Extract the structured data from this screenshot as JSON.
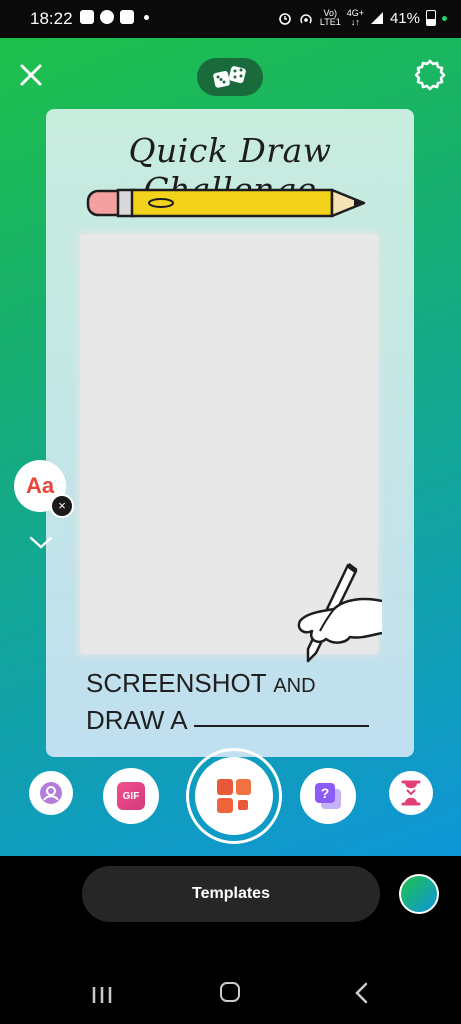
{
  "status_bar": {
    "time": "18:22",
    "network_top": "Vo)",
    "network_bottom": "LTE1",
    "data_top": "4G+",
    "data_bottom": "↓↑",
    "battery": "41%"
  },
  "story_editor": {
    "close_icon": "close-icon",
    "random_icon": "dice-icon",
    "settings_icon": "gear-icon",
    "template": {
      "title": "Quick Draw Challenge",
      "line1_big": "SCREENSHOT",
      "line1_small": "AND",
      "line2": "DRAW A"
    },
    "text_style_label": "Aa",
    "text_style_close": "×"
  },
  "tools": {
    "gif_label": "GIF",
    "items": [
      "avatar-icon",
      "gif-icon",
      "templates-icon",
      "question-icon",
      "hourglass-icon"
    ]
  },
  "bottom": {
    "templates_label": "Templates"
  },
  "colors": {
    "gradient_start": "#1ec04b",
    "gradient_end": "#0f96d8",
    "accent_orange": "#f0643c",
    "accent_purple": "#8d5cf6"
  }
}
